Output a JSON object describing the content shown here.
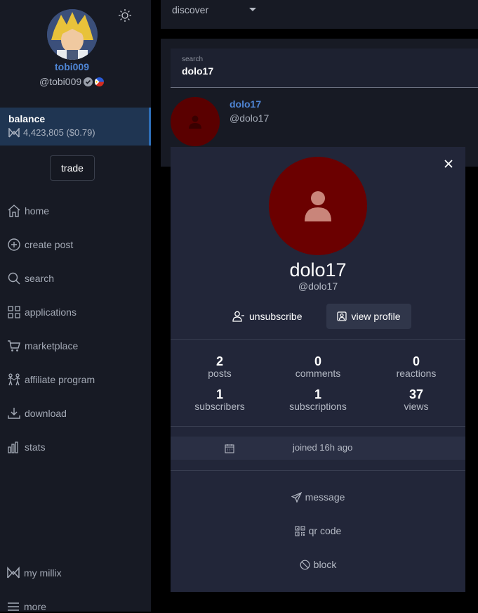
{
  "sidebar": {
    "username": "tobi009",
    "handle": "@tobi009",
    "balance_label": "balance",
    "balance_value": "4,423,805 ($0.79)",
    "trade_label": "trade",
    "nav": [
      {
        "label": "home",
        "icon": "home-icon"
      },
      {
        "label": "create post",
        "icon": "plus-circle-icon"
      },
      {
        "label": "search",
        "icon": "search-icon"
      },
      {
        "label": "applications",
        "icon": "grid-icon"
      },
      {
        "label": "marketplace",
        "icon": "cart-icon"
      },
      {
        "label": "affiliate program",
        "icon": "people-icon"
      },
      {
        "label": "download",
        "icon": "download-icon"
      },
      {
        "label": "stats",
        "icon": "bar-chart-icon"
      }
    ],
    "my_millix": "my millix",
    "more": "more"
  },
  "topbar": {
    "discover_label": "discover"
  },
  "search": {
    "label": "search",
    "value": "dolo17"
  },
  "result": {
    "name": "dolo17",
    "handle": "@dolo17"
  },
  "profile": {
    "name": "dolo17",
    "handle": "@dolo17",
    "unsubscribe_label": "unsubscribe",
    "view_profile_label": "view profile",
    "stats": [
      {
        "value": "2",
        "label": "posts"
      },
      {
        "value": "0",
        "label": "comments"
      },
      {
        "value": "0",
        "label": "reactions"
      },
      {
        "value": "1",
        "label": "subscribers"
      },
      {
        "value": "1",
        "label": "subscriptions"
      },
      {
        "value": "37",
        "label": "views"
      }
    ],
    "joined": "joined 16h ago",
    "actions": {
      "message": "message",
      "qr_code": "qr code",
      "block": "block"
    }
  },
  "colors": {
    "accent": "#4f86d6",
    "avatar_red": "#6b0000"
  }
}
